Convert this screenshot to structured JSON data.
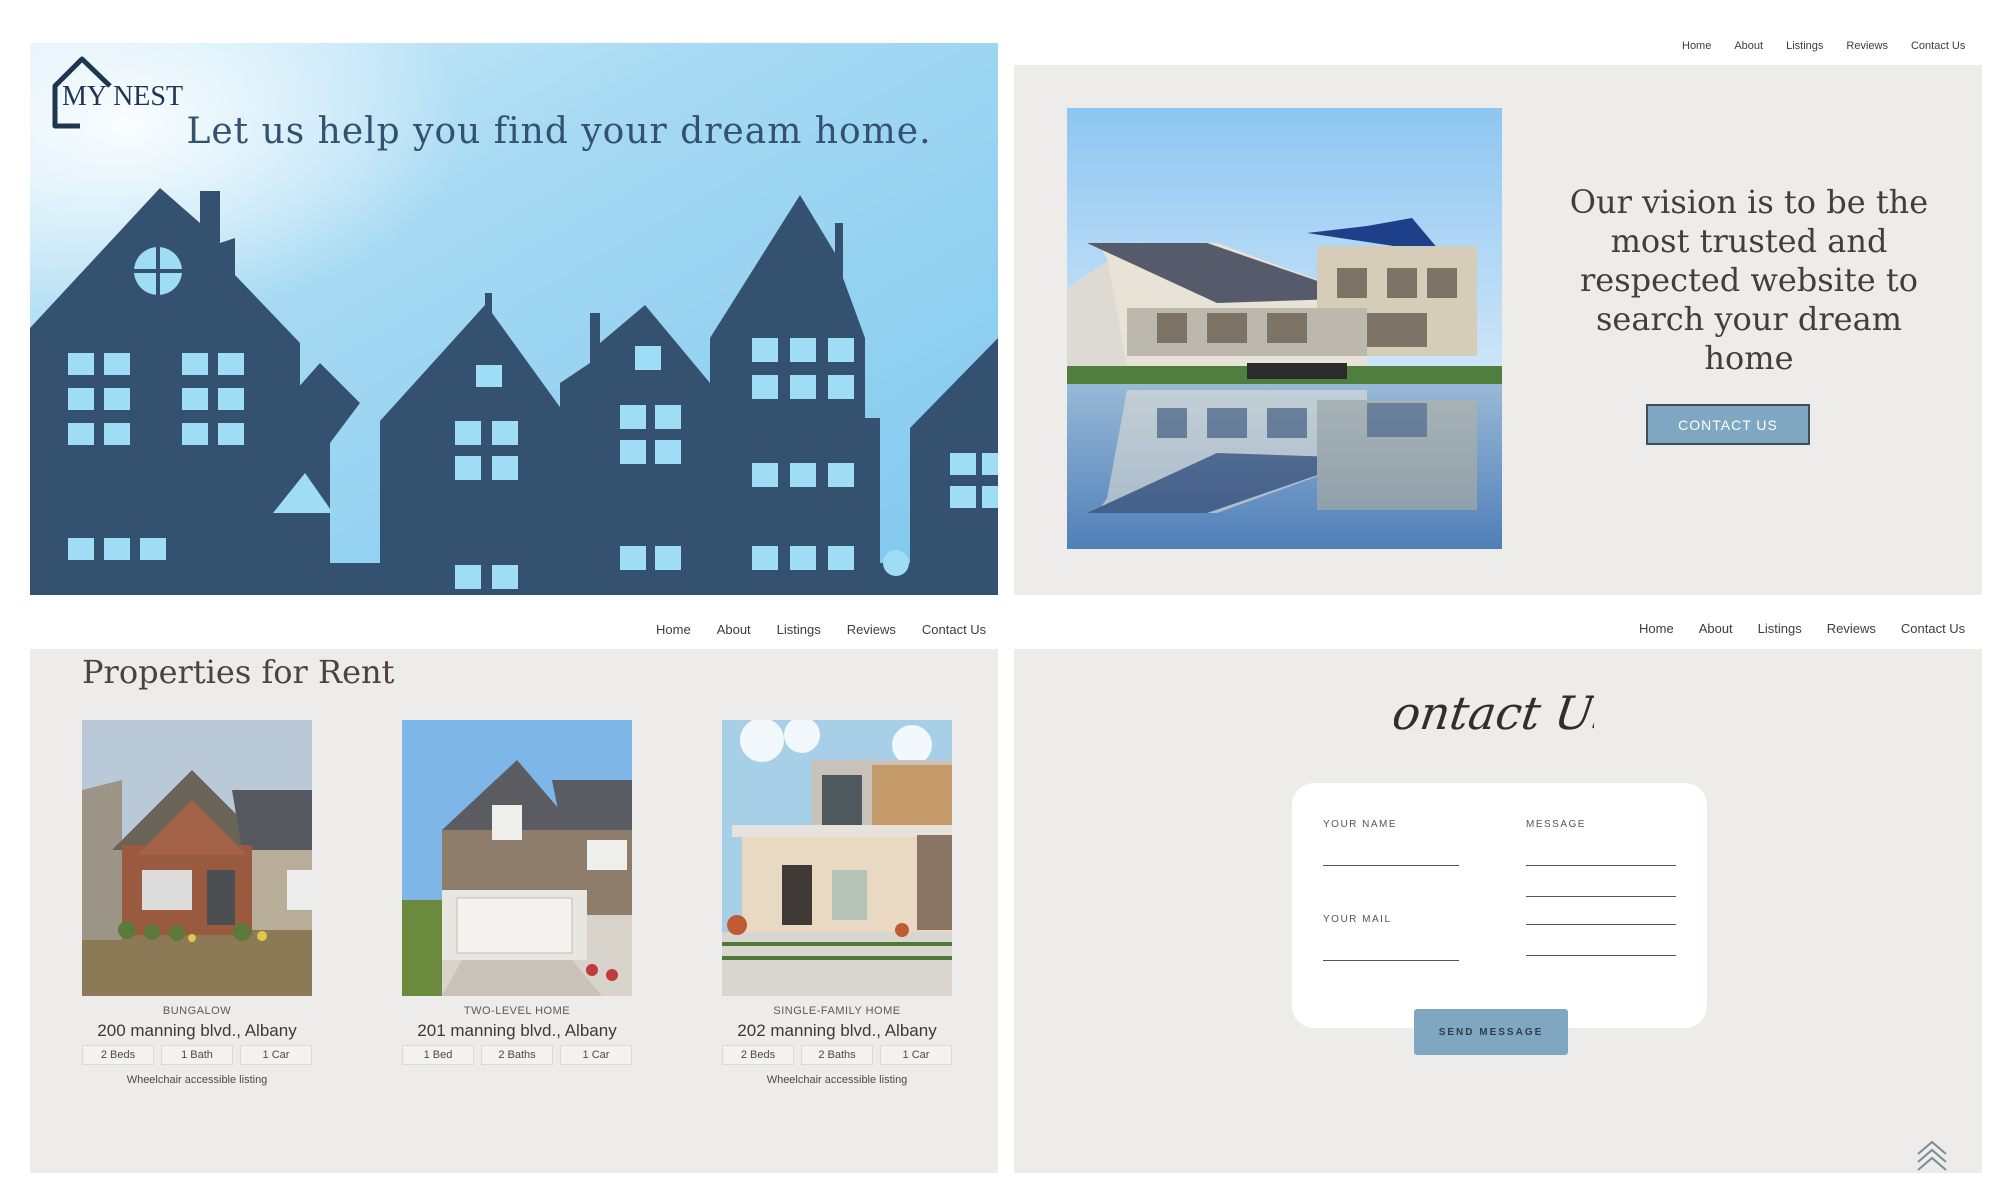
{
  "colors": {
    "navy": "#34526f",
    "sky": "#9bd2ee",
    "accent": "#7fa7c1",
    "panel_bg": "#edecea"
  },
  "hero": {
    "logo_text": "MY NEST",
    "headline": "Let us help you find your dream home."
  },
  "about": {
    "nav": [
      "Home",
      "About",
      "Listings",
      "Reviews",
      "Contact Us"
    ],
    "vision": "Our vision is to be the most trusted and respected website to search your dream home",
    "cta": "CONTACT US"
  },
  "listings": {
    "nav": [
      "Home",
      "About",
      "Listings",
      "Reviews",
      "Contact Us"
    ],
    "title": "Properties for Rent",
    "cards": [
      {
        "type": "BUNGALOW",
        "address": "200 manning blvd., Albany",
        "tags": [
          "2 Beds",
          "1 Bath",
          "1 Car"
        ],
        "note": "Wheelchair accessible listing"
      },
      {
        "type": "TWO-LEVEL HOME",
        "address": "201 manning blvd., Albany",
        "tags": [
          "1 Bed",
          "2 Baths",
          "1 Car"
        ],
        "note": ""
      },
      {
        "type": "SINGLE-FAMILY HOME",
        "address": "202 manning blvd., Albany",
        "tags": [
          "2 Beds",
          "2 Baths",
          "1 Car"
        ],
        "note": "Wheelchair accessible listing"
      }
    ]
  },
  "contact": {
    "nav": [
      "Home",
      "About",
      "Listings",
      "Reviews",
      "Contact Us"
    ],
    "title": "Contact Us",
    "name_label": "YOUR NAME",
    "mail_label": "YOUR MAIL",
    "message_label": "MESSAGE",
    "send": "SEND MESSAGE",
    "scroll_icon": "double-chevron-up-icon"
  }
}
